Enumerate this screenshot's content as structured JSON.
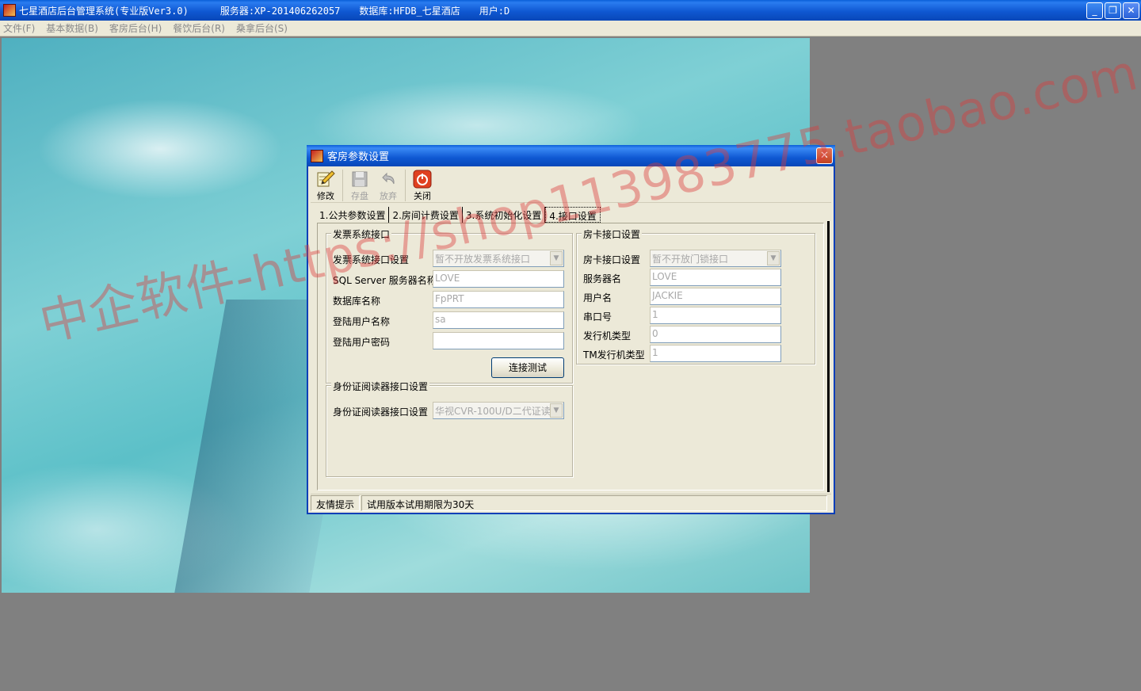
{
  "window": {
    "app_title": "七星酒店后台管理系统(专业版Ver3.0)",
    "server": "服务器:XP-201406262057",
    "database": "数据库:HFDB_七星酒店",
    "user": "用户:D",
    "min_symbol": "_",
    "restore_symbol": "❐",
    "close_symbol": "✕"
  },
  "menubar": {
    "items": [
      {
        "label": "文件(F)"
      },
      {
        "label": "基本数据(B)"
      },
      {
        "label": "客房后台(H)"
      },
      {
        "label": "餐饮后台(R)"
      },
      {
        "label": "桑拿后台(S)"
      }
    ]
  },
  "watermark": "中企软件-https://shop113983775.taobao.com",
  "dialog": {
    "title": "客房参数设置",
    "close_symbol": "✕",
    "toolbar": {
      "modify": "修改",
      "save": "存盘",
      "discard": "放弃",
      "close": "关闭"
    },
    "tabs": [
      {
        "label": "1.公共参数设置"
      },
      {
        "label": "2.房间计费设置"
      },
      {
        "label": "3.系统初始化设置"
      },
      {
        "label": "4.接口设置",
        "active": true
      }
    ],
    "invoice_group": {
      "title": "发票系统接口",
      "interface_label": "发票系统接口设置",
      "interface_value": "暂不开放发票系统接口",
      "sql_server_label": "SQL Server 服务器名称",
      "sql_server_value": "LOVE",
      "db_name_label": "数据库名称",
      "db_name_value": "FpPRT",
      "login_user_label": "登陆用户名称",
      "login_user_value": "sa",
      "login_pwd_label": "登陆用户密码",
      "login_pwd_value": "",
      "test_button": "连接测试"
    },
    "idcard_group": {
      "title": "身份证阅读器接口设置",
      "reader_label": "身份证阅读器接口设置",
      "reader_value": "华视CVR-100U/D二代证读"
    },
    "roomcard_group": {
      "title": "房卡接口设置",
      "interface_label": "房卡接口设置",
      "interface_value": "暂不开放门锁接口",
      "server_label": "服务器名",
      "server_value": "LOVE",
      "user_label": "用户名",
      "user_value": "JACKIE",
      "port_label": "串口号",
      "port_value": "1",
      "issuer_label": "发行机类型",
      "issuer_value": "0",
      "tm_issuer_label": "TM发行机类型",
      "tm_issuer_value": "1"
    },
    "status": {
      "hint": "友情提示",
      "message": "试用版本试用期限为30天"
    }
  }
}
